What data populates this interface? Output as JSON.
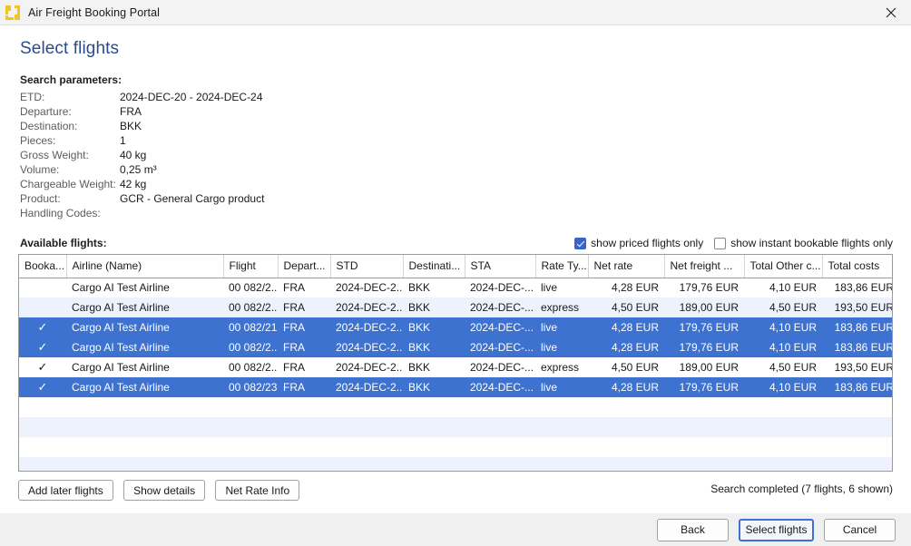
{
  "window": {
    "title": "Air Freight Booking Portal",
    "app_icon": "grid-squares-icon",
    "close_icon": "close-icon"
  },
  "page": {
    "title": "Select flights"
  },
  "search_parameters": {
    "heading": "Search parameters:",
    "rows": [
      {
        "label": "ETD:",
        "value": "2024-DEC-20 - 2024-DEC-24"
      },
      {
        "label": "Departure:",
        "value": "FRA"
      },
      {
        "label": "Destination:",
        "value": "BKK"
      },
      {
        "label": "Pieces:",
        "value": "1"
      },
      {
        "label": "Gross Weight:",
        "value": "40 kg"
      },
      {
        "label": "Volume:",
        "value": "0,25 m³"
      },
      {
        "label": "Chargeable Weight:",
        "value": "42 kg"
      },
      {
        "label": "Product:",
        "value": "GCR - General Cargo product"
      },
      {
        "label": "Handling Codes:",
        "value": ""
      }
    ]
  },
  "available_flights": {
    "heading": "Available flights:",
    "filters": [
      {
        "label": "show priced flights only",
        "checked": true
      },
      {
        "label": "show instant bookable flights only",
        "checked": false
      }
    ],
    "columns": [
      "Booka...",
      "Airline (Name)",
      "Flight",
      "Depart...",
      "STD",
      "Destinati...",
      "STA",
      "Rate Ty...",
      "Net rate",
      "Net freight ...",
      "Total Other c...",
      "Total costs"
    ],
    "rows": [
      {
        "bookable": "",
        "airline": "Cargo AI Test Airline",
        "flight": "00 082/2...",
        "departure": "FRA",
        "std": "2024-DEC-2...",
        "destination": "BKK",
        "sta": "2024-DEC-...",
        "rate_type": "live",
        "net_rate": "4,28 EUR",
        "net_freight": "179,76 EUR",
        "total_other_costs": "4,10 EUR",
        "total_costs": "183,86 EUR",
        "selected": false
      },
      {
        "bookable": "",
        "airline": "Cargo AI Test Airline",
        "flight": "00 082/2...",
        "departure": "FRA",
        "std": "2024-DEC-2...",
        "destination": "BKK",
        "sta": "2024-DEC-...",
        "rate_type": "express",
        "net_rate": "4,50 EUR",
        "net_freight": "189,00 EUR",
        "total_other_costs": "4,50 EUR",
        "total_costs": "193,50 EUR",
        "selected": false
      },
      {
        "bookable": "✓",
        "airline": "Cargo AI Test Airline",
        "flight": "00 082/21",
        "departure": "FRA",
        "std": "2024-DEC-2...",
        "destination": "BKK",
        "sta": "2024-DEC-...",
        "rate_type": "live",
        "net_rate": "4,28 EUR",
        "net_freight": "179,76 EUR",
        "total_other_costs": "4,10 EUR",
        "total_costs": "183,86 EUR",
        "selected": true
      },
      {
        "bookable": "✓",
        "airline": "Cargo AI Test Airline",
        "flight": "00 082/2...",
        "departure": "FRA",
        "std": "2024-DEC-2...",
        "destination": "BKK",
        "sta": "2024-DEC-...",
        "rate_type": "live",
        "net_rate": "4,28 EUR",
        "net_freight": "179,76 EUR",
        "total_other_costs": "4,10 EUR",
        "total_costs": "183,86 EUR",
        "selected": true
      },
      {
        "bookable": "✓",
        "airline": "Cargo AI Test Airline",
        "flight": "00 082/2...",
        "departure": "FRA",
        "std": "2024-DEC-2...",
        "destination": "BKK",
        "sta": "2024-DEC-...",
        "rate_type": "express",
        "net_rate": "4,50 EUR",
        "net_freight": "189,00 EUR",
        "total_other_costs": "4,50 EUR",
        "total_costs": "193,50 EUR",
        "selected": false
      },
      {
        "bookable": "✓",
        "airline": "Cargo AI Test Airline",
        "flight": "00 082/23",
        "departure": "FRA",
        "std": "2024-DEC-2...",
        "destination": "BKK",
        "sta": "2024-DEC-...",
        "rate_type": "live",
        "net_rate": "4,28 EUR",
        "net_freight": "179,76 EUR",
        "total_other_costs": "4,10 EUR",
        "total_costs": "183,86 EUR",
        "selected": true
      }
    ],
    "empty_row_count": 4
  },
  "grid_actions": {
    "add_later_flights": "Add later flights",
    "show_details": "Show details",
    "net_rate_info": "Net Rate Info",
    "status": "Search completed (7 flights, 6 shown)"
  },
  "footer": {
    "back": "Back",
    "select_flights": "Select flights",
    "cancel": "Cancel"
  },
  "colors": {
    "title_blue": "#2a4b8d",
    "selection_blue": "#3d72d0",
    "alt_row": "#eef2fc",
    "accent_checkbox": "#3a63c8",
    "icon_yellow": "#f0c52a"
  }
}
